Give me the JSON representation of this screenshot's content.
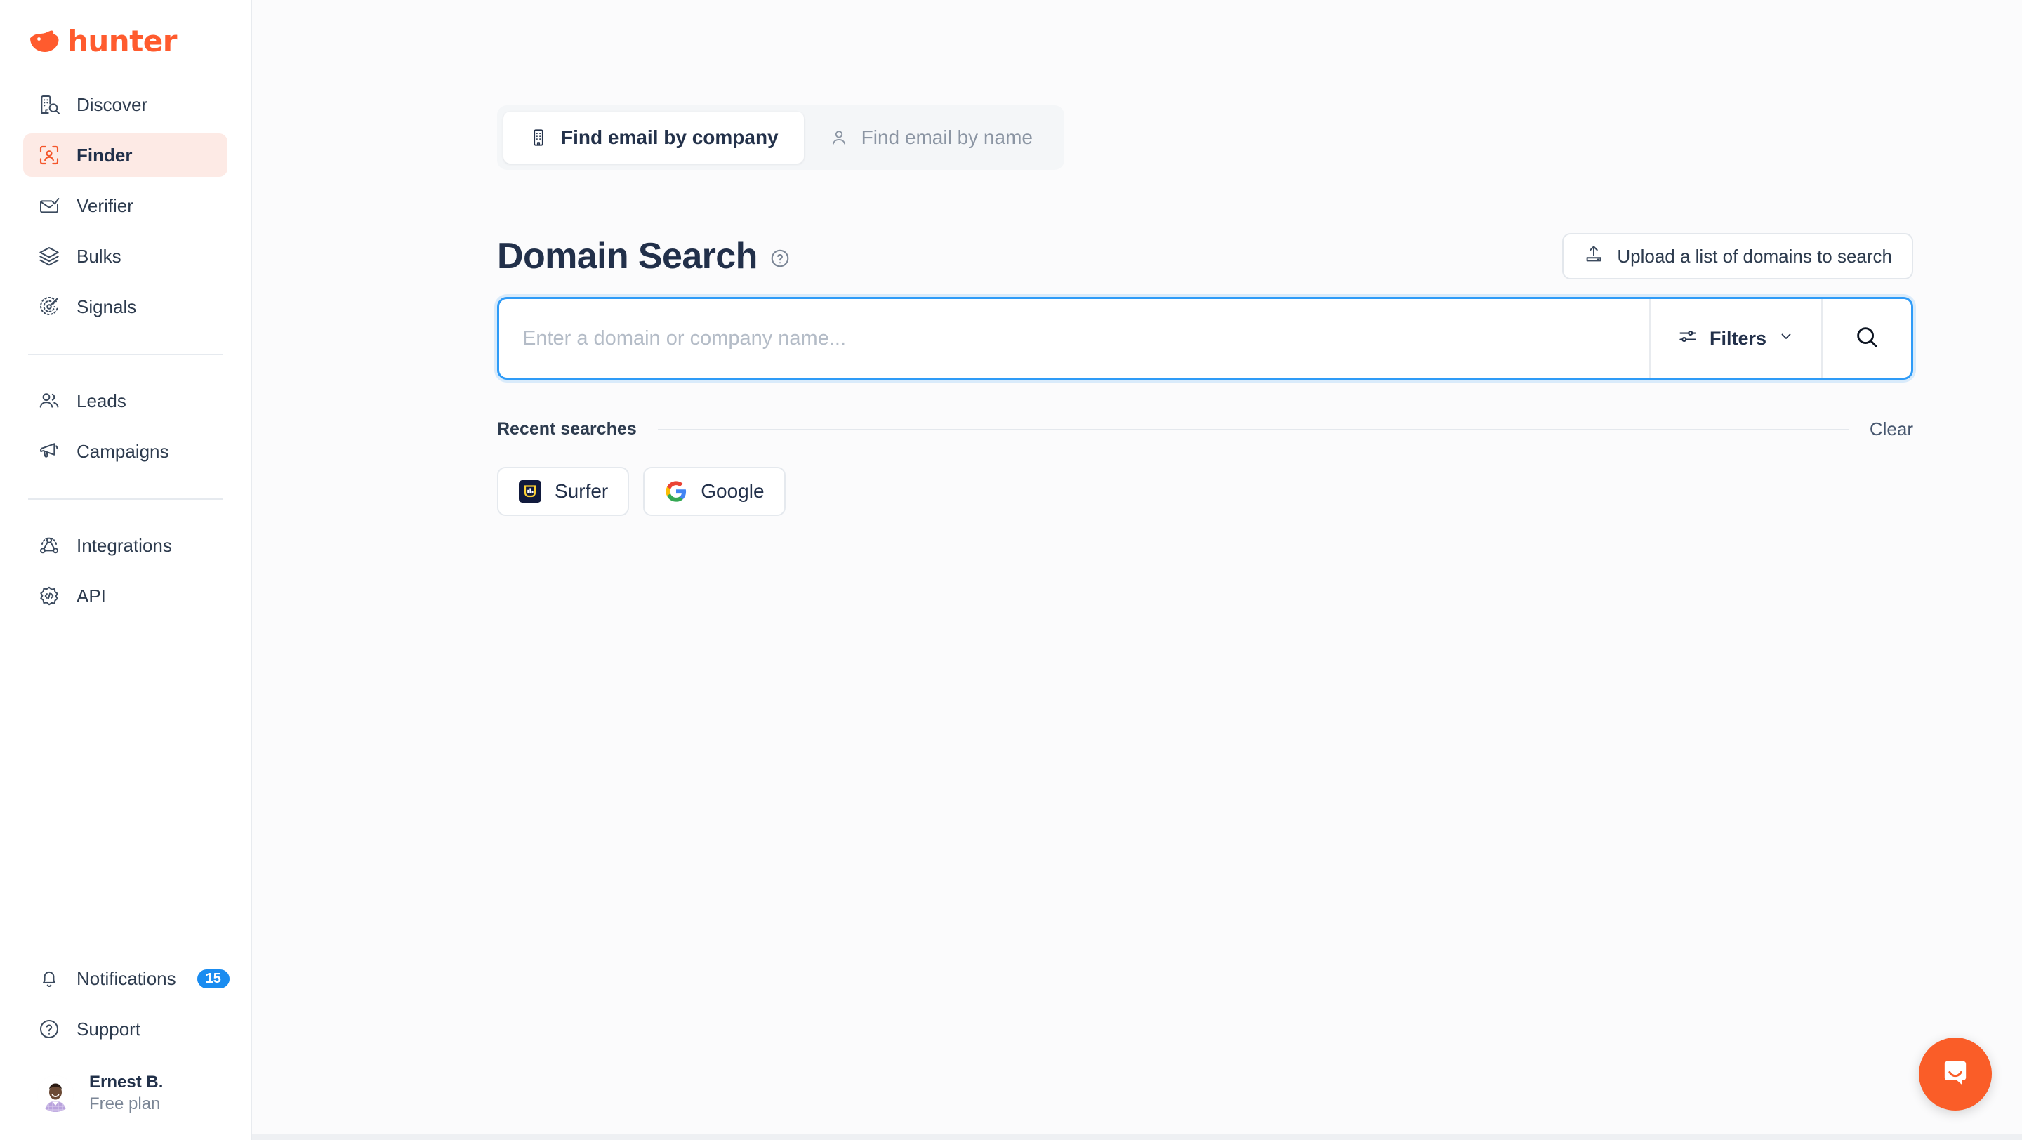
{
  "brand": {
    "name": "hunter",
    "logo_icon": "fox-head-icon",
    "color": "#ff5b2e"
  },
  "sidebar": {
    "primary_items": [
      {
        "label": "Discover",
        "icon": "building-search-icon",
        "active": false
      },
      {
        "label": "Finder",
        "icon": "person-scan-icon",
        "active": true
      },
      {
        "label": "Verifier",
        "icon": "envelope-check-icon",
        "active": false
      },
      {
        "label": "Bulks",
        "icon": "layers-icon",
        "active": false
      },
      {
        "label": "Signals",
        "icon": "radar-target-icon",
        "active": false
      }
    ],
    "secondary_items": [
      {
        "label": "Leads",
        "icon": "users-icon"
      },
      {
        "label": "Campaigns",
        "icon": "megaphone-icon"
      }
    ],
    "tertiary_items": [
      {
        "label": "Integrations",
        "icon": "integrations-network-icon"
      },
      {
        "label": "API",
        "icon": "gear-code-icon"
      }
    ],
    "bottom_items": [
      {
        "label": "Notifications",
        "icon": "bell-icon",
        "badge": "15",
        "badge_color": "#1a8cf0"
      },
      {
        "label": "Support",
        "icon": "question-circle-icon",
        "badge": ""
      }
    ],
    "user": {
      "name": "Ernest B.",
      "plan": "Free plan",
      "avatar": "user-photo-avatar"
    }
  },
  "main": {
    "tabs": [
      {
        "label": "Find email by company",
        "icon": "building-icon",
        "active": true
      },
      {
        "label": "Find email by name",
        "icon": "person-icon",
        "active": false
      }
    ],
    "page_title": "Domain Search",
    "help_icon": "question-circle-icon",
    "upload_button": {
      "label": "Upload a list of domains to search",
      "icon": "upload-icon"
    },
    "search": {
      "value": "",
      "placeholder": "Enter a domain or company name...",
      "filters_label": "Filters",
      "filters_icon": "sliders-icon",
      "chevron_icon": "chevron-down-icon",
      "submit_icon": "search-icon",
      "focus_color": "#2e9bf7"
    },
    "recent": {
      "label": "Recent searches",
      "clear_label": "Clear",
      "items": [
        {
          "label": "Surfer",
          "icon": "surfer-logo-icon"
        },
        {
          "label": "Google",
          "icon": "google-logo-icon"
        }
      ]
    },
    "chat_launcher": {
      "icon": "intercom-chat-icon",
      "color": "#fa5d28"
    }
  }
}
